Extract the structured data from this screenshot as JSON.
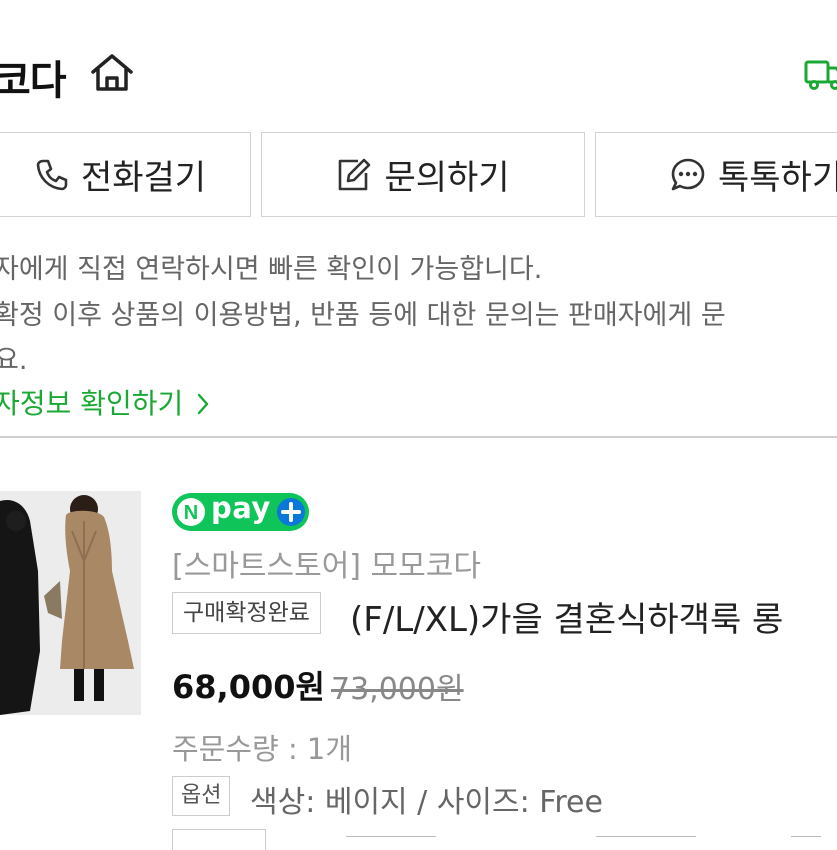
{
  "header": {
    "store_title": "코다",
    "home_icon": "home-icon",
    "delivery_icon": "truck-icon",
    "accent": "#1aa834"
  },
  "actions": {
    "call_label": "전화걸기",
    "inquiry_label": "문의하기",
    "talk_label": "톡톡하기"
  },
  "notice": {
    "line1": "자에게 직접 연락하시면 빠른 확인이 가능합니다.",
    "line2": "확정 이후 상품의 이용방법, 반품 등에 대한 문의는 판매자에게 문",
    "line3": "요.",
    "privacy_link": "자정보 확인하기"
  },
  "product": {
    "pay_badge": "pay",
    "store_name": "[스마트스토어] 모모코다",
    "status": "구매확정완료",
    "title": "(F/L/XL)가을 결혼식하객룩 롱",
    "price": "68,000원",
    "original_price": "73,000원",
    "quantity": "주문수량 : 1개",
    "option_label": "옵션",
    "option_value": "색상: 베이지 / 사이즈: Free",
    "npay_color": "#0fc55a"
  }
}
